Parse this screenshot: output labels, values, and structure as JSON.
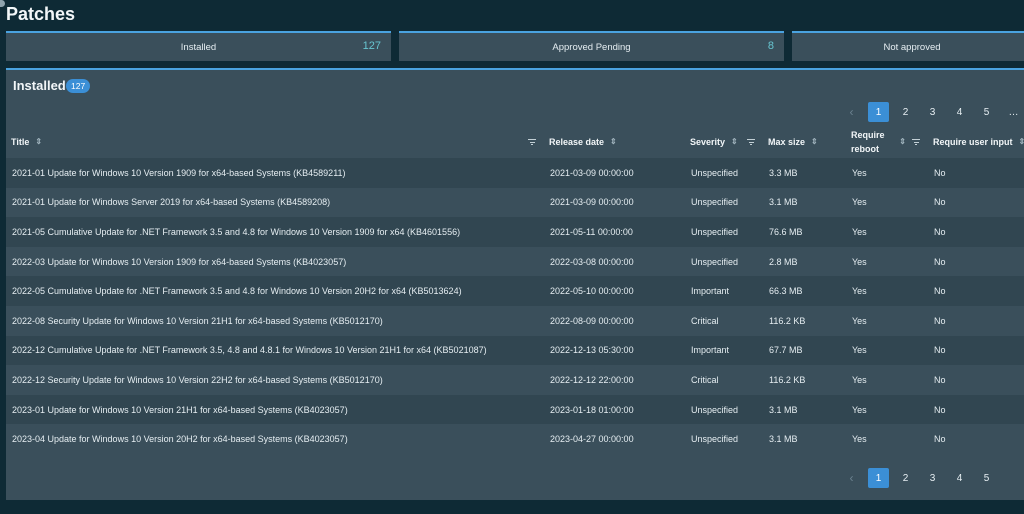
{
  "page": {
    "title": "Patches"
  },
  "summary": {
    "installed": {
      "label": "Installed",
      "count": "127"
    },
    "approved_pending": {
      "label": "Approved Pending",
      "count": "8"
    },
    "not_approved": {
      "label": "Not approved"
    }
  },
  "panel": {
    "title": "Installed",
    "badge": "127"
  },
  "pagination": {
    "prev": "‹",
    "pages": [
      "1",
      "2",
      "3",
      "4",
      "5"
    ],
    "more": "…",
    "active": "1"
  },
  "table": {
    "headers": {
      "title": "Title",
      "release_date": "Release date",
      "severity": "Severity",
      "max_size": "Max size",
      "require_reboot_1": "Require",
      "require_reboot_2": "reboot",
      "require_user_input": "Require user input"
    },
    "rows": [
      {
        "title": "2021-01 Update for Windows 10 Version 1909 for x64-based Systems (KB4589211)",
        "release_date": "2021-03-09 00:00:00",
        "severity": "Unspecified",
        "max_size": "3.3 MB",
        "require_reboot": "Yes",
        "require_user_input": "No"
      },
      {
        "title": "2021-01 Update for Windows Server 2019 for x64-based Systems (KB4589208)",
        "release_date": "2021-03-09 00:00:00",
        "severity": "Unspecified",
        "max_size": "3.1 MB",
        "require_reboot": "Yes",
        "require_user_input": "No"
      },
      {
        "title": "2021-05 Cumulative Update for .NET Framework 3.5 and 4.8 for Windows 10 Version 1909 for x64 (KB4601556)",
        "release_date": "2021-05-11 00:00:00",
        "severity": "Unspecified",
        "max_size": "76.6 MB",
        "require_reboot": "Yes",
        "require_user_input": "No"
      },
      {
        "title": "2022-03 Update for Windows 10 Version 1909 for x64-based Systems (KB4023057)",
        "release_date": "2022-03-08 00:00:00",
        "severity": "Unspecified",
        "max_size": "2.8 MB",
        "require_reboot": "Yes",
        "require_user_input": "No"
      },
      {
        "title": "2022-05 Cumulative Update for .NET Framework 3.5 and 4.8 for Windows 10 Version 20H2 for x64 (KB5013624)",
        "release_date": "2022-05-10 00:00:00",
        "severity": "Important",
        "max_size": "66.3 MB",
        "require_reboot": "Yes",
        "require_user_input": "No"
      },
      {
        "title": "2022-08 Security Update for Windows 10 Version 21H1 for x64-based Systems (KB5012170)",
        "release_date": "2022-08-09 00:00:00",
        "severity": "Critical",
        "max_size": "116.2 KB",
        "require_reboot": "Yes",
        "require_user_input": "No"
      },
      {
        "title": "2022-12 Cumulative Update for .NET Framework 3.5, 4.8 and 4.8.1 for Windows 10 Version 21H1 for x64 (KB5021087)",
        "release_date": "2022-12-13 05:30:00",
        "severity": "Important",
        "max_size": "67.7 MB",
        "require_reboot": "Yes",
        "require_user_input": "No"
      },
      {
        "title": "2022-12 Security Update for Windows 10 Version 22H2 for x64-based Systems (KB5012170)",
        "release_date": "2022-12-12 22:00:00",
        "severity": "Critical",
        "max_size": "116.2 KB",
        "require_reboot": "Yes",
        "require_user_input": "No"
      },
      {
        "title": "2023-01 Update for Windows 10 Version 21H1 for x64-based Systems (KB4023057)",
        "release_date": "2023-01-18 01:00:00",
        "severity": "Unspecified",
        "max_size": "3.1 MB",
        "require_reboot": "Yes",
        "require_user_input": "No"
      },
      {
        "title": "2023-04 Update for Windows 10 Version 20H2 for x64-based Systems (KB4023057)",
        "release_date": "2023-04-27 00:00:00",
        "severity": "Unspecified",
        "max_size": "3.1 MB",
        "require_reboot": "Yes",
        "require_user_input": "No"
      }
    ]
  }
}
